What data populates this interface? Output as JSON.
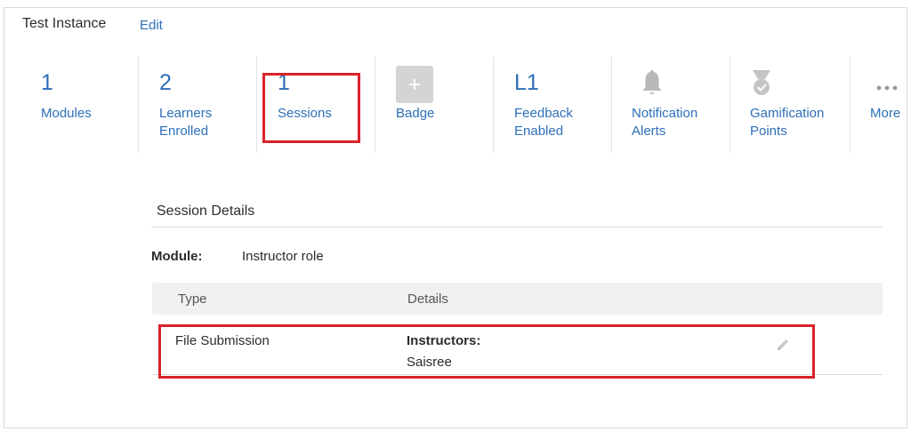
{
  "header": {
    "title": "Test Instance",
    "edit_label": "Edit"
  },
  "stats": [
    {
      "value": "1",
      "label_line1": "Modules",
      "label_line2": ""
    },
    {
      "value": "2",
      "label_line1": "Learners",
      "label_line2": "Enrolled"
    },
    {
      "value": "1",
      "label_line1": "Sessions",
      "label_line2": ""
    },
    {
      "value": "",
      "label_line1": "Badge",
      "label_line2": ""
    },
    {
      "value": "L1",
      "label_line1": "Feedback",
      "label_line2": "Enabled"
    },
    {
      "value": "",
      "label_line1": "Notification",
      "label_line2": "Alerts"
    },
    {
      "value": "",
      "label_line1": "Gamification",
      "label_line2": "Points"
    },
    {
      "value": "",
      "label_line1": "More",
      "label_line2": ""
    }
  ],
  "icons": {
    "badge": "plus-icon",
    "notification": "bell-icon",
    "gamification": "medal-icon",
    "more": "ellipsis-icon",
    "edit_row": "pencil-icon"
  },
  "session": {
    "title": "Session Details",
    "module_label": "Module:",
    "module_value": "Instructor role",
    "columns": {
      "type": "Type",
      "details": "Details"
    },
    "rows": [
      {
        "type": "File Submission",
        "instructors_label": "Instructors:",
        "instructors_value": "Saisree"
      }
    ]
  },
  "colors": {
    "link": "#2d6fb8",
    "highlight": "#d8222a",
    "icon_gray": "#b9b9b9"
  }
}
